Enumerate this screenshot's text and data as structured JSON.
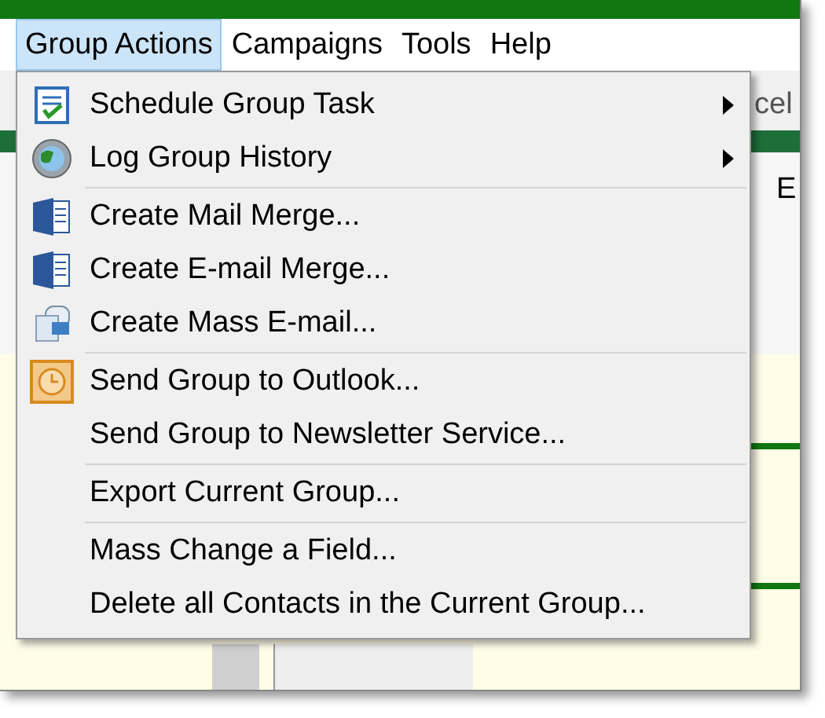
{
  "menu_bar": [
    {
      "label": "Group Actions",
      "selected": true
    },
    {
      "label": "Campaigns",
      "selected": false
    },
    {
      "label": "Tools",
      "selected": false
    },
    {
      "label": "Help",
      "selected": false
    }
  ],
  "menu": [
    {
      "kind": "item",
      "label": "Schedule Group Task",
      "has_submenu": true
    },
    {
      "kind": "item",
      "label": "Log Group History",
      "has_submenu": true
    },
    {
      "kind": "separator"
    },
    {
      "kind": "item",
      "label": "Create Mail Merge...",
      "has_submenu": false
    },
    {
      "kind": "item",
      "label": "Create E-mail Merge...",
      "has_submenu": false
    },
    {
      "kind": "item",
      "label": "Create Mass E-mail...",
      "has_submenu": false
    },
    {
      "kind": "separator"
    },
    {
      "kind": "item",
      "label": "Send Group to Outlook...",
      "has_submenu": false
    },
    {
      "kind": "item",
      "label": "Send Group to Newsletter Service...",
      "has_submenu": false
    },
    {
      "kind": "separator"
    },
    {
      "kind": "item",
      "label": "Export Current Group...",
      "has_submenu": false
    },
    {
      "kind": "separator"
    },
    {
      "kind": "item",
      "label": "Mass Change a Field...",
      "has_submenu": false
    },
    {
      "kind": "item",
      "label": "Delete all Contacts in the Current Group...",
      "has_submenu": false
    }
  ],
  "background_fragments": [
    "cel",
    "E"
  ]
}
